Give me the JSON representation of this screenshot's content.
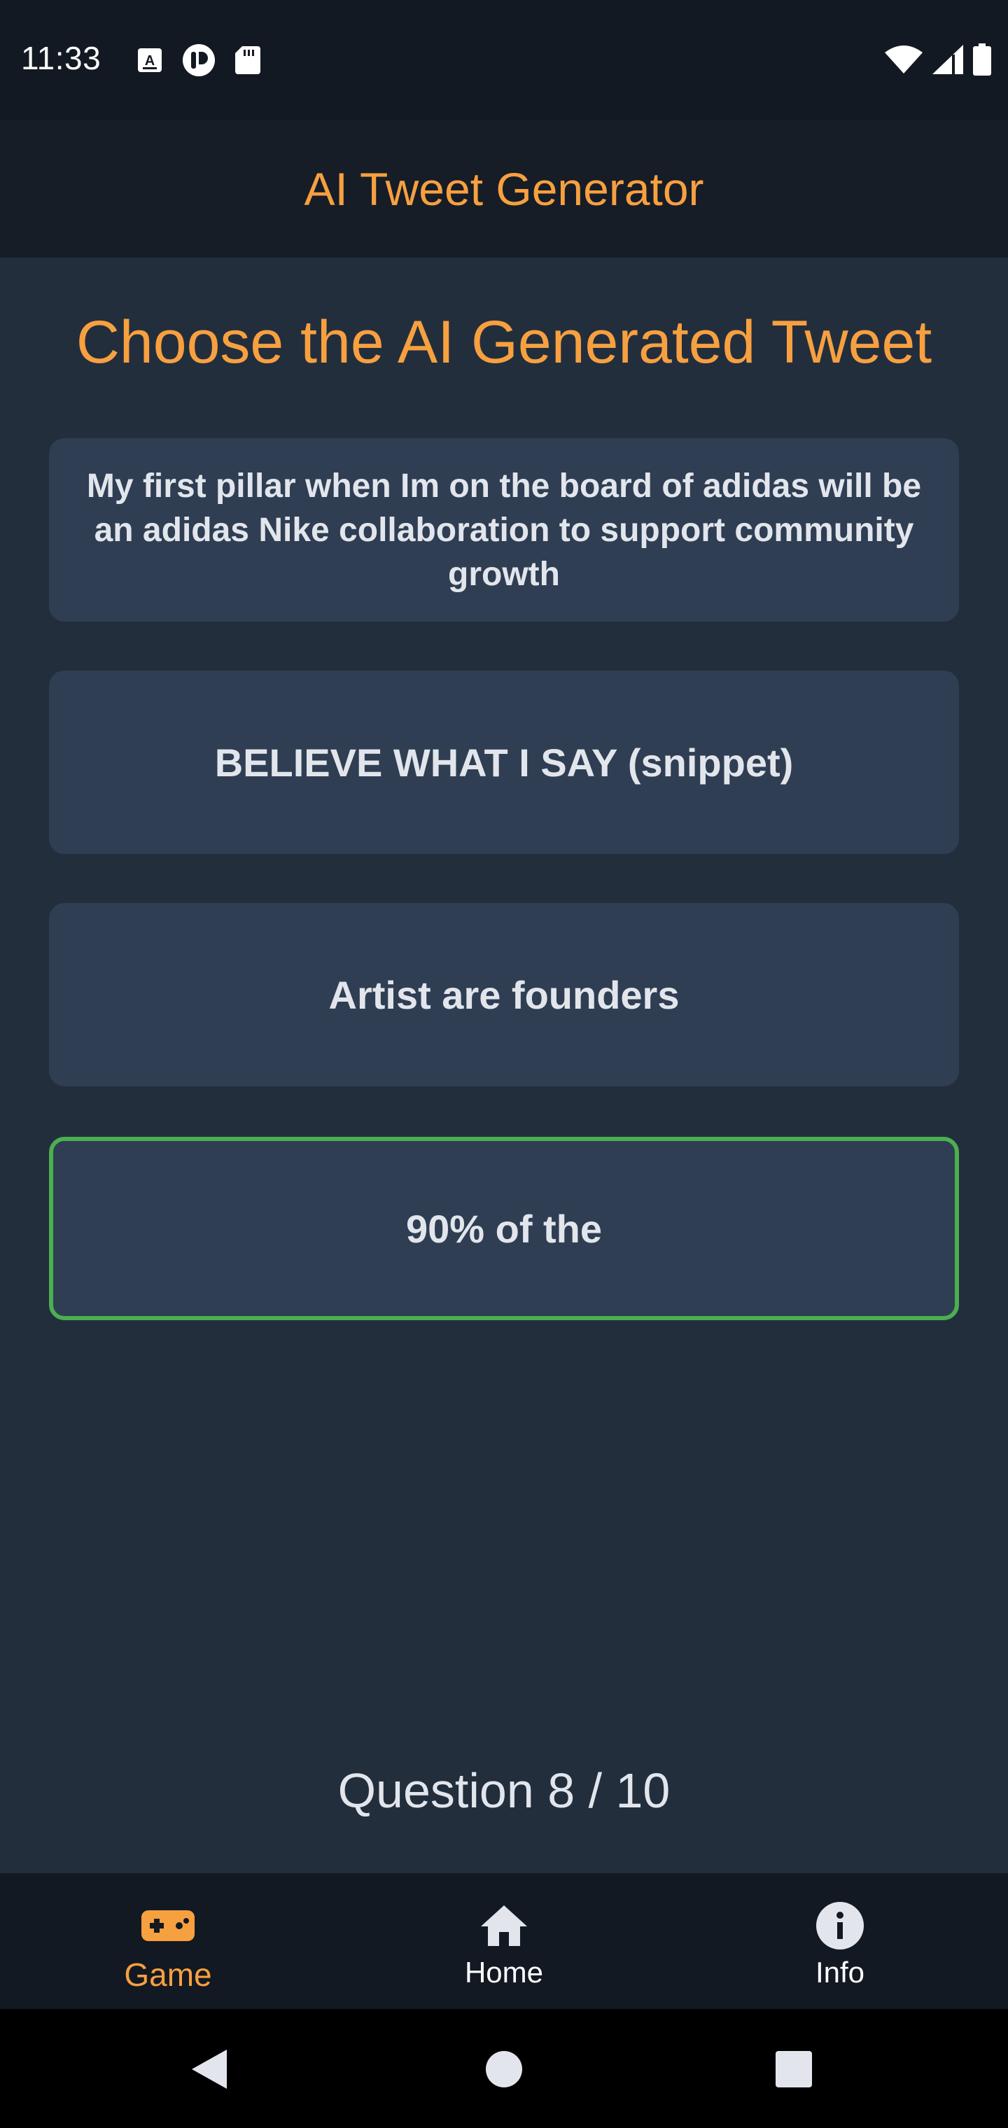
{
  "status_bar": {
    "time": "11:33",
    "left_icons": [
      "font-icon",
      "app-notification-icon",
      "sd-card-icon"
    ],
    "right_icons": [
      "wifi-icon",
      "signal-icon",
      "battery-icon"
    ]
  },
  "app_bar": {
    "title": "AI Tweet Generator"
  },
  "game": {
    "heading": "Choose the AI Generated Tweet",
    "options": [
      {
        "text": "My first pillar when Im on the board of adidas will be an adidas Nike collaboration to support community growth"
      },
      {
        "text": "BELIEVE WHAT I SAY (snippet)"
      },
      {
        "text": "Artist are founders"
      },
      {
        "text": "90% of the",
        "selected": true
      }
    ],
    "question_counter": "Question 8 / 10"
  },
  "bottom_nav": {
    "items": [
      {
        "label": "Game",
        "icon": "gamepad-icon",
        "active": true
      },
      {
        "label": "Home",
        "icon": "home-icon",
        "active": false
      },
      {
        "label": "Info",
        "icon": "info-icon",
        "active": false
      }
    ]
  },
  "colors": {
    "accent": "#f7a040",
    "selected_border": "#4caf50",
    "background": "#232e3d",
    "card": "#2f3e53"
  }
}
